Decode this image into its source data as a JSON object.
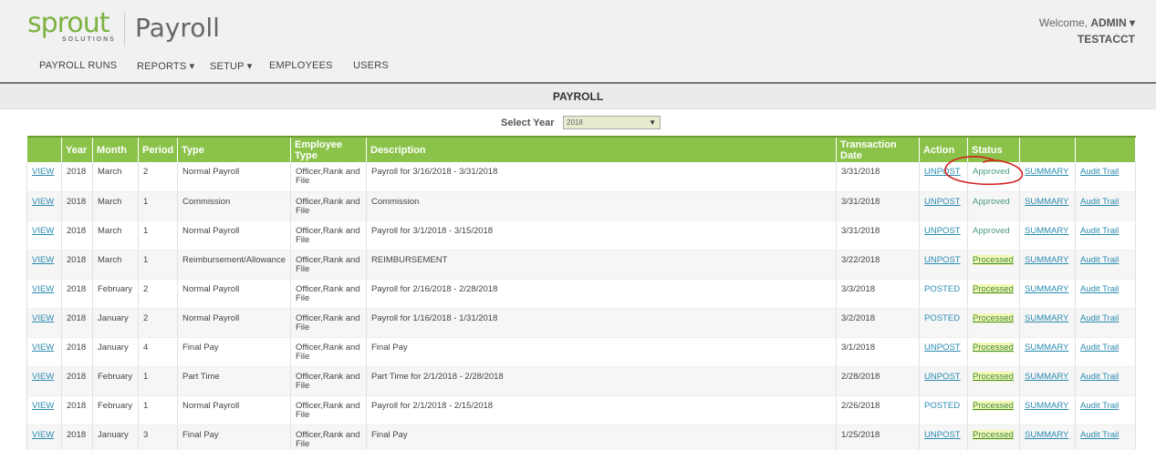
{
  "brand": {
    "logo_word": "sprout",
    "logo_sub": "SOLUTIONS",
    "app_title": "Payroll"
  },
  "user": {
    "welcome_prefix": "Welcome, ",
    "name": "ADMIN ▾",
    "account": "TESTACCT"
  },
  "nav": [
    {
      "label": "PAYROLL RUNS"
    },
    {
      "label": "REPORTS ▾"
    },
    {
      "label": "SETUP ▾"
    },
    {
      "label": "EMPLOYEES"
    },
    {
      "label": "USERS"
    }
  ],
  "page": {
    "title": "PAYROLL",
    "year_label": "Select Year",
    "year_value": "2018"
  },
  "table": {
    "headers": [
      "",
      "Year",
      "Month",
      "Period",
      "Type",
      "Employee Type",
      "Description",
      "Transaction Date",
      "Action",
      "Status",
      "",
      ""
    ],
    "rows": [
      {
        "view": "VIEW",
        "year": "2018",
        "month": "March",
        "period": "2",
        "type": "Normal Payroll",
        "emp_type": "Officer,Rank and File",
        "desc": "Payroll for 3/16/2018 - 3/31/2018",
        "date": "3/31/2018",
        "action": "UNPOST",
        "status": "Approved",
        "summary": "SUMMARY",
        "audit": "Audit Trail"
      },
      {
        "view": "VIEW",
        "year": "2018",
        "month": "March",
        "period": "1",
        "type": "Commission",
        "emp_type": "Officer,Rank and File",
        "desc": "Commission",
        "date": "3/31/2018",
        "action": "UNPOST",
        "status": "Approved",
        "summary": "SUMMARY",
        "audit": "Audit Trail"
      },
      {
        "view": "VIEW",
        "year": "2018",
        "month": "March",
        "period": "1",
        "type": "Normal Payroll",
        "emp_type": "Officer,Rank and File",
        "desc": "Payroll for 3/1/2018 - 3/15/2018",
        "date": "3/31/2018",
        "action": "UNPOST",
        "status": "Approved",
        "summary": "SUMMARY",
        "audit": "Audit Trail"
      },
      {
        "view": "VIEW",
        "year": "2018",
        "month": "March",
        "period": "1",
        "type": "Reimbursement/Allowance",
        "emp_type": "Officer,Rank and File",
        "desc": "REIMBURSEMENT",
        "date": "3/22/2018",
        "action": "UNPOST",
        "status": "Processed",
        "summary": "SUMMARY",
        "audit": "Audit Trail"
      },
      {
        "view": "VIEW",
        "year": "2018",
        "month": "February",
        "period": "2",
        "type": "Normal Payroll",
        "emp_type": "Officer,Rank and File",
        "desc": "Payroll for 2/16/2018 - 2/28/2018",
        "date": "3/3/2018",
        "action": "POSTED",
        "status": "Processed",
        "summary": "SUMMARY",
        "audit": "Audit Trail"
      },
      {
        "view": "VIEW",
        "year": "2018",
        "month": "January",
        "period": "2",
        "type": "Normal Payroll",
        "emp_type": "Officer,Rank and File",
        "desc": "Payroll for 1/16/2018 - 1/31/2018",
        "date": "3/2/2018",
        "action": "POSTED",
        "status": "Processed",
        "summary": "SUMMARY",
        "audit": "Audit Trail"
      },
      {
        "view": "VIEW",
        "year": "2018",
        "month": "January",
        "period": "4",
        "type": "Final Pay",
        "emp_type": "Officer,Rank and File",
        "desc": "Final Pay",
        "date": "3/1/2018",
        "action": "UNPOST",
        "status": "Processed",
        "summary": "SUMMARY",
        "audit": "Audit Trail"
      },
      {
        "view": "VIEW",
        "year": "2018",
        "month": "February",
        "period": "1",
        "type": "Part Time",
        "emp_type": "Officer,Rank and File",
        "desc": "Part Time for 2/1/2018 - 2/28/2018",
        "date": "2/28/2018",
        "action": "UNPOST",
        "status": "Processed",
        "summary": "SUMMARY",
        "audit": "Audit Trail"
      },
      {
        "view": "VIEW",
        "year": "2018",
        "month": "February",
        "period": "1",
        "type": "Normal Payroll",
        "emp_type": "Officer,Rank and File",
        "desc": "Payroll for 2/1/2018 - 2/15/2018",
        "date": "2/26/2018",
        "action": "POSTED",
        "status": "Processed",
        "summary": "SUMMARY",
        "audit": "Audit Trail"
      },
      {
        "view": "VIEW",
        "year": "2018",
        "month": "January",
        "period": "3",
        "type": "Final Pay",
        "emp_type": "Officer,Rank and File",
        "desc": "Final Pay",
        "date": "1/25/2018",
        "action": "UNPOST",
        "status": "Processed",
        "summary": "SUMMARY",
        "audit": "Audit Trail"
      }
    ]
  },
  "colors": {
    "brand_green": "#7cb342",
    "header_green": "#8bc34a",
    "link_blue": "#2a8bb0",
    "annotation_red": "#d42020"
  }
}
